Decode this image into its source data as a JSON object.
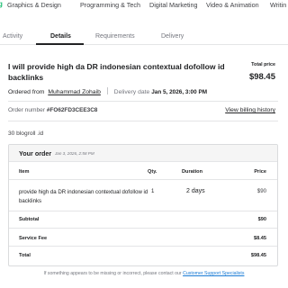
{
  "top_nav": {
    "logo_fragment": "g",
    "items": [
      "Graphics & Design",
      "Programming & Tech",
      "Digital Marketing",
      "Video & Animation",
      "Writin"
    ]
  },
  "tabs": [
    "Activity",
    "Details",
    "Requirements",
    "Delivery"
  ],
  "active_tab": "Details",
  "order": {
    "title": "I will provide high da DR indonesian contextual dofollow id backlinks",
    "total_price_label": "Total price",
    "total_price": "$98.45",
    "ordered_from_label": "Ordered from",
    "seller": "Muhammad Zohaib",
    "delivery_label": "Delivery date",
    "delivery_date": "Jan 5, 2026, 3:00 PM",
    "order_number_label": "Order number",
    "order_number": "#FO62FD3CEE3C8",
    "billing_history_link": "View billing history",
    "quantity_note": "30 blogroll .id"
  },
  "your_order": {
    "title": "Your order",
    "date": "Jan 3, 2026, 2:58 PM",
    "columns": [
      "Item",
      "Qty.",
      "Duration",
      "Price"
    ],
    "rows": [
      {
        "item": "provide high da DR indonesian contextual dofollow id backlinks",
        "qty": "1",
        "duration": "2 days",
        "price": "$90"
      }
    ],
    "subtotal_label": "Subtotal",
    "subtotal": "$90",
    "service_fee_label": "Service Fee",
    "service_fee": "$8.45",
    "total_label": "Total",
    "total": "$98.45"
  },
  "footer": {
    "note_prefix": "If something appears to be missing or incorrect, please contact our",
    "support_link": "Customer Support Specialists"
  },
  "colors": {
    "brand_green": "#1dbf73",
    "link_blue": "#1a7bd5",
    "text_dark": "#222325",
    "text_muted": "#74767e",
    "border": "#e4e5e7",
    "card_header_bg": "#f5f5f5"
  }
}
